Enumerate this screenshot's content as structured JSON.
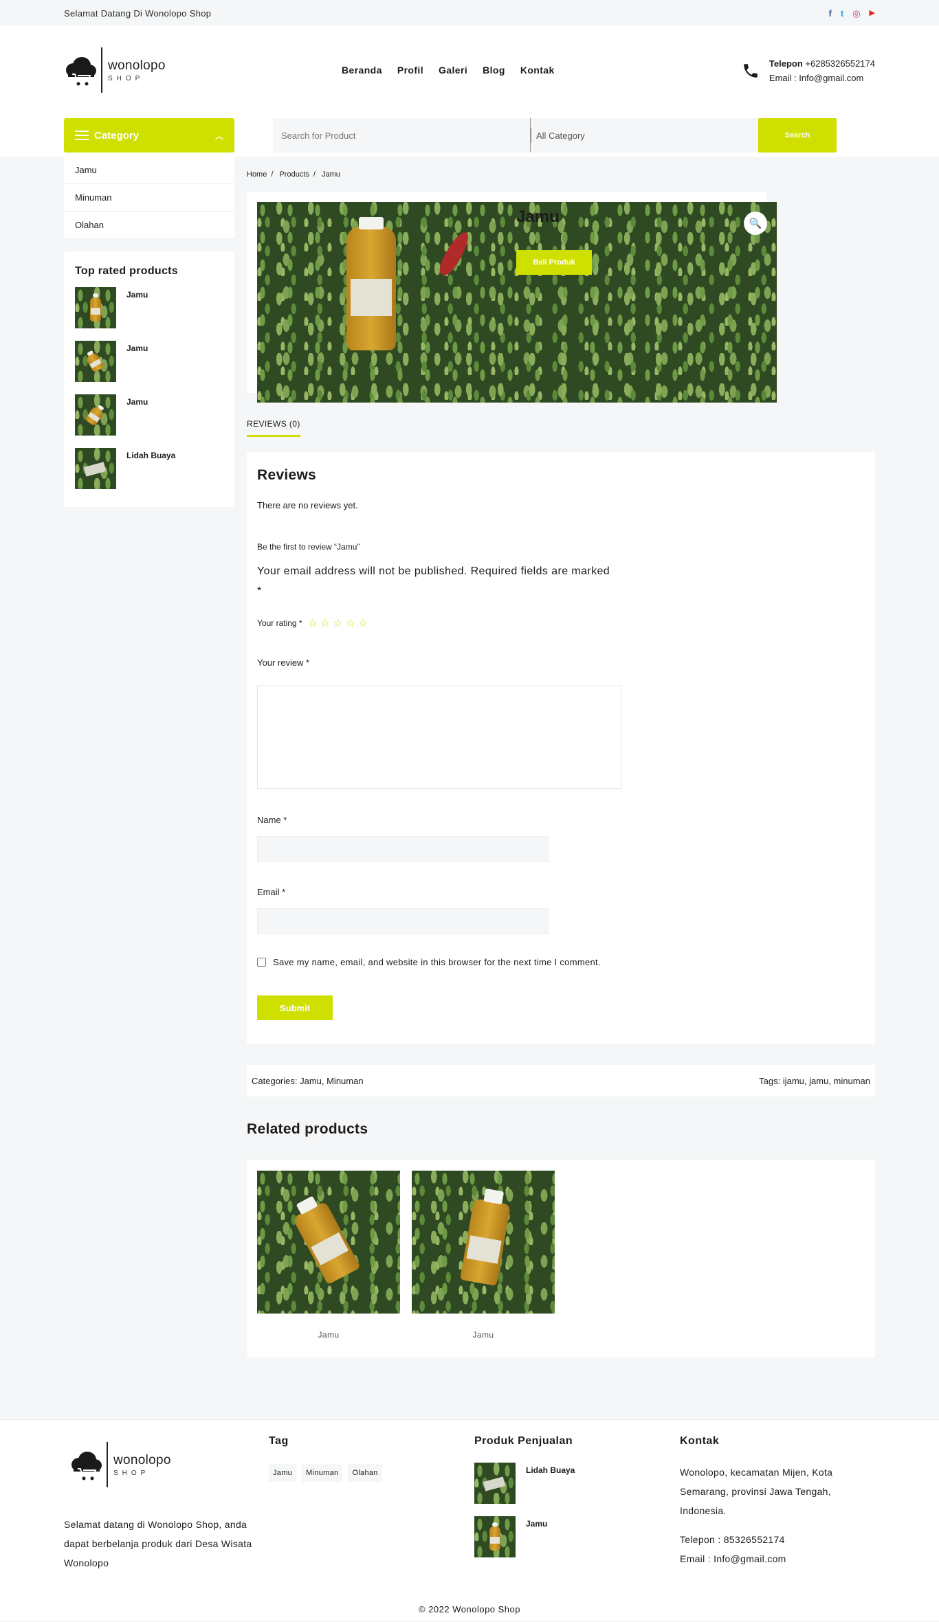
{
  "topbar": {
    "welcome": "Selamat Datang Di Wonolopo Shop"
  },
  "socials": [
    {
      "icon": "facebook-icon",
      "glyph": "f",
      "color": "#3b5998"
    },
    {
      "icon": "twitter-icon",
      "glyph": "t",
      "color": "#1da1f2"
    },
    {
      "icon": "instagram-icon",
      "glyph": "◎",
      "color": "#c13584"
    },
    {
      "icon": "youtube-icon",
      "glyph": "▶",
      "color": "#e62117"
    }
  ],
  "logo": {
    "line1": "wonolopo",
    "line2": "SHOP"
  },
  "nav": [
    "Beranda",
    "Profil",
    "Galeri",
    "Blog",
    "Kontak"
  ],
  "header_contact": {
    "phone_label": "Telepon",
    "phone": "+6285326552174",
    "email": "Email : Info@gmail.com"
  },
  "category": {
    "label": "Category",
    "items": [
      "Jamu",
      "Minuman",
      "Olahan"
    ]
  },
  "search": {
    "placeholder": "Search for Product",
    "category_select": "All Category",
    "button": "Search"
  },
  "top_rated": {
    "title": "Top rated products",
    "items": [
      "Jamu",
      "Jamu",
      "Jamu",
      "Lidah Buaya"
    ]
  },
  "breadcrumb": [
    "Home",
    "Products",
    "Jamu"
  ],
  "product": {
    "title": "Jamu",
    "buy_label": "Beli Produk"
  },
  "tab": "REVIEWS (0)",
  "reviews": {
    "title": "Reviews",
    "none": "There are no reviews yet.",
    "first": "Be the first to review “Jamu”",
    "notice": "Your email address will not be published. Required fields are marked *",
    "rating_label": "Your rating *",
    "stars": "☆☆☆☆☆",
    "review_label": "Your review *",
    "name_label": "Name *",
    "email_label": "Email *",
    "save_label": "Save my name, email, and website in this browser for the next time I comment.",
    "submit": "Submit"
  },
  "meta": {
    "categories": "Categories: Jamu, Minuman",
    "tags": "Tags: ijamu, jamu, minuman"
  },
  "related": {
    "title": "Related products",
    "items": [
      "Jamu",
      "Jamu"
    ]
  },
  "footer": {
    "about": "Selamat datang di Wonolopo Shop, anda dapat berbelanja produk dari Desa Wisata Wonolopo",
    "tag_title": "Tag",
    "tags": [
      "Jamu",
      "Minuman",
      "Olahan"
    ],
    "produk_title": "Produk Penjualan",
    "produk_items": [
      "Lidah Buaya",
      "Jamu"
    ],
    "kontak_title": "Kontak",
    "address": "Wonolopo, kecamatan Mijen, Kota Semarang, provinsi Jawa Tengah, Indonesia.",
    "phone": "Telepon : 85326552174",
    "email": "Email : Info@gmail.com",
    "copyright": "© 2022 Wonolopo Shop"
  },
  "colors": {
    "accent": "#cfdf00",
    "bg": "#f4f6f7"
  }
}
